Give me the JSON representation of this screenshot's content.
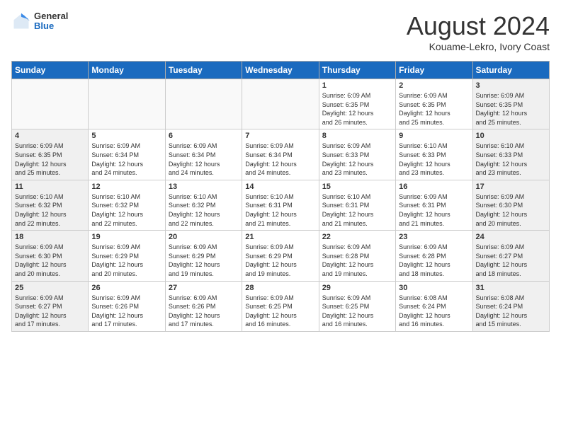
{
  "header": {
    "logo_general": "General",
    "logo_blue": "Blue",
    "title": "August 2024",
    "location": "Kouame-Lekro, Ivory Coast"
  },
  "days_of_week": [
    "Sunday",
    "Monday",
    "Tuesday",
    "Wednesday",
    "Thursday",
    "Friday",
    "Saturday"
  ],
  "weeks": [
    [
      {
        "day": "",
        "info": ""
      },
      {
        "day": "",
        "info": ""
      },
      {
        "day": "",
        "info": ""
      },
      {
        "day": "",
        "info": ""
      },
      {
        "day": "1",
        "info": "Sunrise: 6:09 AM\nSunset: 6:35 PM\nDaylight: 12 hours\nand 26 minutes."
      },
      {
        "day": "2",
        "info": "Sunrise: 6:09 AM\nSunset: 6:35 PM\nDaylight: 12 hours\nand 25 minutes."
      },
      {
        "day": "3",
        "info": "Sunrise: 6:09 AM\nSunset: 6:35 PM\nDaylight: 12 hours\nand 25 minutes."
      }
    ],
    [
      {
        "day": "4",
        "info": "Sunrise: 6:09 AM\nSunset: 6:35 PM\nDaylight: 12 hours\nand 25 minutes."
      },
      {
        "day": "5",
        "info": "Sunrise: 6:09 AM\nSunset: 6:34 PM\nDaylight: 12 hours\nand 24 minutes."
      },
      {
        "day": "6",
        "info": "Sunrise: 6:09 AM\nSunset: 6:34 PM\nDaylight: 12 hours\nand 24 minutes."
      },
      {
        "day": "7",
        "info": "Sunrise: 6:09 AM\nSunset: 6:34 PM\nDaylight: 12 hours\nand 24 minutes."
      },
      {
        "day": "8",
        "info": "Sunrise: 6:09 AM\nSunset: 6:33 PM\nDaylight: 12 hours\nand 23 minutes."
      },
      {
        "day": "9",
        "info": "Sunrise: 6:10 AM\nSunset: 6:33 PM\nDaylight: 12 hours\nand 23 minutes."
      },
      {
        "day": "10",
        "info": "Sunrise: 6:10 AM\nSunset: 6:33 PM\nDaylight: 12 hours\nand 23 minutes."
      }
    ],
    [
      {
        "day": "11",
        "info": "Sunrise: 6:10 AM\nSunset: 6:32 PM\nDaylight: 12 hours\nand 22 minutes."
      },
      {
        "day": "12",
        "info": "Sunrise: 6:10 AM\nSunset: 6:32 PM\nDaylight: 12 hours\nand 22 minutes."
      },
      {
        "day": "13",
        "info": "Sunrise: 6:10 AM\nSunset: 6:32 PM\nDaylight: 12 hours\nand 22 minutes."
      },
      {
        "day": "14",
        "info": "Sunrise: 6:10 AM\nSunset: 6:31 PM\nDaylight: 12 hours\nand 21 minutes."
      },
      {
        "day": "15",
        "info": "Sunrise: 6:10 AM\nSunset: 6:31 PM\nDaylight: 12 hours\nand 21 minutes."
      },
      {
        "day": "16",
        "info": "Sunrise: 6:09 AM\nSunset: 6:31 PM\nDaylight: 12 hours\nand 21 minutes."
      },
      {
        "day": "17",
        "info": "Sunrise: 6:09 AM\nSunset: 6:30 PM\nDaylight: 12 hours\nand 20 minutes."
      }
    ],
    [
      {
        "day": "18",
        "info": "Sunrise: 6:09 AM\nSunset: 6:30 PM\nDaylight: 12 hours\nand 20 minutes."
      },
      {
        "day": "19",
        "info": "Sunrise: 6:09 AM\nSunset: 6:29 PM\nDaylight: 12 hours\nand 20 minutes."
      },
      {
        "day": "20",
        "info": "Sunrise: 6:09 AM\nSunset: 6:29 PM\nDaylight: 12 hours\nand 19 minutes."
      },
      {
        "day": "21",
        "info": "Sunrise: 6:09 AM\nSunset: 6:29 PM\nDaylight: 12 hours\nand 19 minutes."
      },
      {
        "day": "22",
        "info": "Sunrise: 6:09 AM\nSunset: 6:28 PM\nDaylight: 12 hours\nand 19 minutes."
      },
      {
        "day": "23",
        "info": "Sunrise: 6:09 AM\nSunset: 6:28 PM\nDaylight: 12 hours\nand 18 minutes."
      },
      {
        "day": "24",
        "info": "Sunrise: 6:09 AM\nSunset: 6:27 PM\nDaylight: 12 hours\nand 18 minutes."
      }
    ],
    [
      {
        "day": "25",
        "info": "Sunrise: 6:09 AM\nSunset: 6:27 PM\nDaylight: 12 hours\nand 17 minutes."
      },
      {
        "day": "26",
        "info": "Sunrise: 6:09 AM\nSunset: 6:26 PM\nDaylight: 12 hours\nand 17 minutes."
      },
      {
        "day": "27",
        "info": "Sunrise: 6:09 AM\nSunset: 6:26 PM\nDaylight: 12 hours\nand 17 minutes."
      },
      {
        "day": "28",
        "info": "Sunrise: 6:09 AM\nSunset: 6:25 PM\nDaylight: 12 hours\nand 16 minutes."
      },
      {
        "day": "29",
        "info": "Sunrise: 6:09 AM\nSunset: 6:25 PM\nDaylight: 12 hours\nand 16 minutes."
      },
      {
        "day": "30",
        "info": "Sunrise: 6:08 AM\nSunset: 6:24 PM\nDaylight: 12 hours\nand 16 minutes."
      },
      {
        "day": "31",
        "info": "Sunrise: 6:08 AM\nSunset: 6:24 PM\nDaylight: 12 hours\nand 15 minutes."
      }
    ]
  ]
}
